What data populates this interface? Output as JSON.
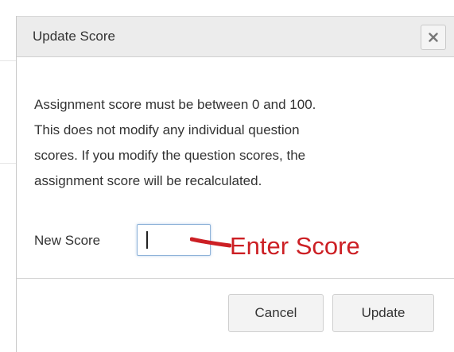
{
  "dialog": {
    "title": "Update Score",
    "close_icon": "close-icon",
    "message_lines": [
      "Assignment score must be between 0 and 100.",
      "This does not modify any individual question",
      "scores. If you modify the question scores, the",
      "assignment score will be recalculated."
    ],
    "score_label": "New Score",
    "score_value": "",
    "annotation": "Enter Score",
    "annotation_color": "#cc1f24",
    "buttons": {
      "cancel": "Cancel",
      "update": "Update"
    }
  }
}
